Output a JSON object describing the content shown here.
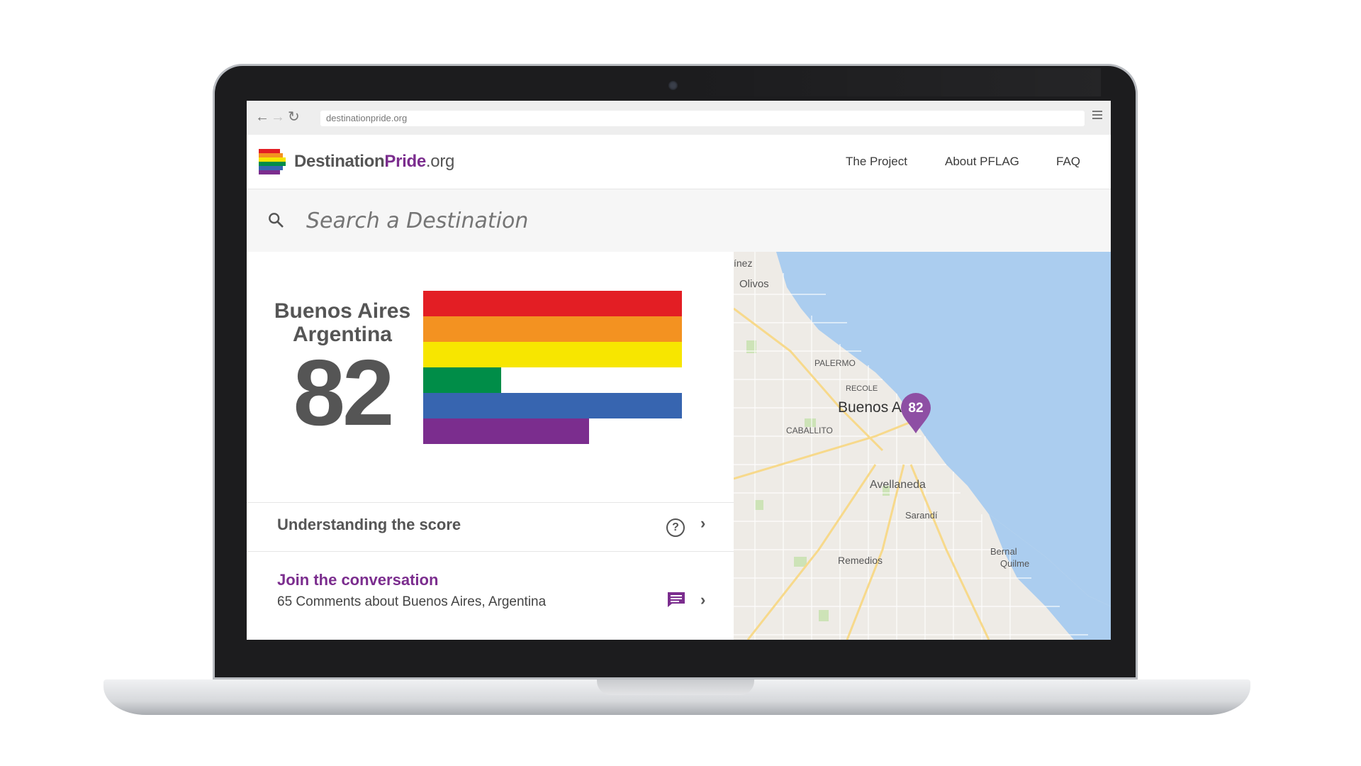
{
  "browser": {
    "url": "destinationpride.org"
  },
  "header": {
    "logo_main": "Destination",
    "logo_accent": "Pride",
    "logo_suffix": ".org",
    "nav": [
      "The Project",
      "About PFLAG",
      "FAQ"
    ]
  },
  "search": {
    "placeholder": "Search a Destination"
  },
  "destination": {
    "city": "Buenos Aires",
    "country": "Argentina",
    "score": "82",
    "score_bars": [
      {
        "color": "#e31e24",
        "level": 1.0
      },
      {
        "color": "#f39221",
        "level": 1.0
      },
      {
        "color": "#f7e600",
        "level": 1.0
      },
      {
        "color": "#008d48",
        "level": 0.3
      },
      {
        "color": "#3765b0",
        "level": 1.0
      },
      {
        "color": "#7b2d8e",
        "level": 0.64
      }
    ]
  },
  "understanding": {
    "label": "Understanding the score"
  },
  "conversation": {
    "title": "Join the conversation",
    "subtitle": "65 Comments about Buenos Aires, Argentina"
  },
  "map": {
    "labels": {
      "olivos": "Olivos",
      "inez": "ínez",
      "palermo": "PALERMO",
      "recoleta": "RECOLE",
      "buenos_aires": "Buenos Aires",
      "caballito": "CABALLITO",
      "avellaneda": "Avellaneda",
      "sarandi": "Sarandí",
      "bernal": "Bernal",
      "remedios": "Remedios",
      "quilmes": "Quilme"
    },
    "pin_score": "82",
    "colors": {
      "water": "#abcdef",
      "land": "#eeebe6",
      "accent": "#8e4fa4"
    }
  }
}
